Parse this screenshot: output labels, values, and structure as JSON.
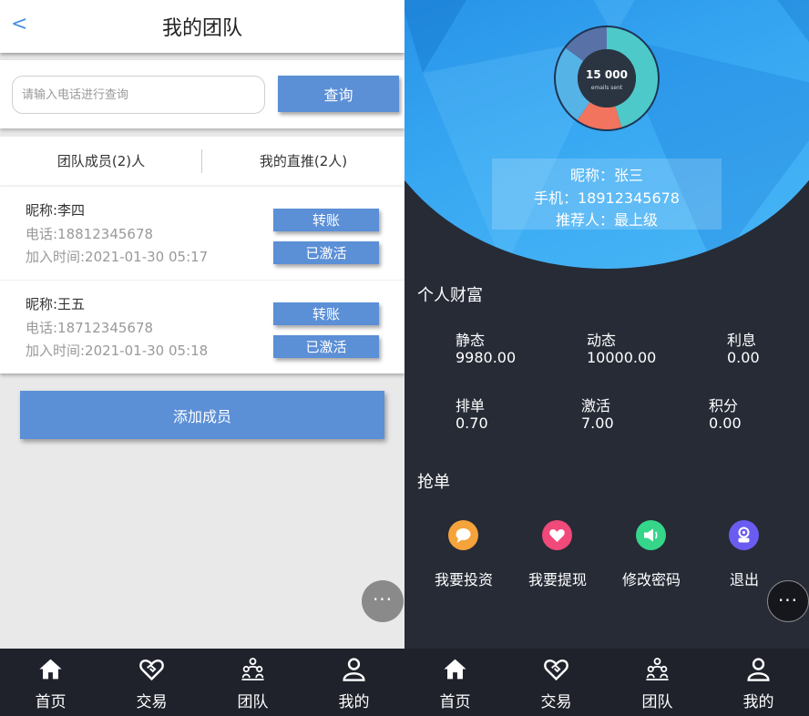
{
  "left": {
    "header": {
      "back": "<",
      "title": "我的团队"
    },
    "search": {
      "placeholder": "请输入电话进行查询",
      "button": "查询"
    },
    "tabs": [
      {
        "label": "团队成员(2)人"
      },
      {
        "label": "我的直推(2人)"
      }
    ],
    "members": [
      {
        "name": "昵称:李四",
        "phone": "电话:18812345678",
        "time": "加入时间:2021-01-30 05:17",
        "btn1": "转账",
        "btn2": "已激活"
      },
      {
        "name": "昵称:王五",
        "phone": "电话:18712345678",
        "time": "加入时间:2021-01-30 05:18",
        "btn1": "转账",
        "btn2": "已激活"
      }
    ],
    "add_button": "添加成员",
    "more": "···"
  },
  "nav": [
    {
      "label": "首页",
      "icon": "home-icon"
    },
    {
      "label": "交易",
      "icon": "handshake-heart-icon"
    },
    {
      "label": "团队",
      "icon": "team-icon"
    },
    {
      "label": "我的",
      "icon": "user-icon"
    }
  ],
  "right": {
    "donut": {
      "value": "15 000",
      "caption": "emails sent",
      "colors": {
        "teal": "#4ec9c9",
        "salmon": "#f2735e",
        "sky": "#56b3e6",
        "slate": "#5872a8",
        "center": "#2b3542"
      }
    },
    "profile": {
      "nickname": "昵称：张三",
      "phone": "手机：18912345678",
      "referrer": "推荐人：最上级"
    },
    "wealth": {
      "title": "个人财富",
      "items": [
        {
          "label": "静态",
          "value": "9980.00"
        },
        {
          "label": "动态",
          "value": "10000.00"
        },
        {
          "label": "利息",
          "value": "0.00"
        },
        {
          "label": "排单",
          "value": "0.70"
        },
        {
          "label": "激活",
          "value": "7.00"
        },
        {
          "label": "积分",
          "value": "0.00"
        }
      ]
    },
    "orders": {
      "title": "抢单",
      "actions": [
        {
          "label": "我要投资",
          "icon": "chat-bubble-icon",
          "color": "#f5a33a"
        },
        {
          "label": "我要提现",
          "icon": "heart-icon",
          "color": "#f0497a"
        },
        {
          "label": "修改密码",
          "icon": "megaphone-icon",
          "color": "#35d58a"
        },
        {
          "label": "退出",
          "icon": "robot-icon",
          "color": "#6a5cf0"
        }
      ]
    },
    "more": "···"
  }
}
